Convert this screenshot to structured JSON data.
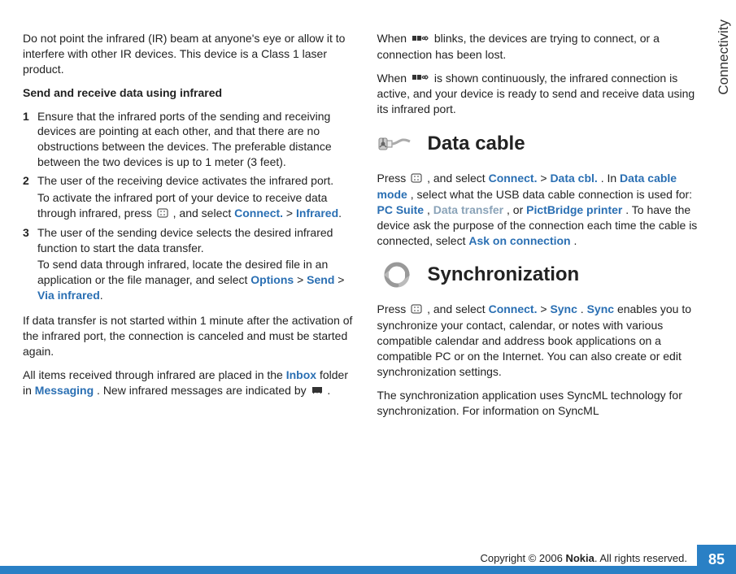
{
  "sideTab": "Connectivity",
  "pageNumber": "85",
  "copyright": {
    "prefix": "Copyright © 2006 ",
    "brand": "Nokia",
    "suffix": ". All rights reserved."
  },
  "left": {
    "intro": "Do not point the infrared (IR) beam at anyone's eye or allow it to interfere with other IR devices. This device is a Class 1 laser product.",
    "subhead": "Send and receive data using infrared",
    "step1": "Ensure that the infrared ports of the sending and receiving devices are pointing at each other, and that there are no obstructions between the devices. The preferable distance between the two devices is up to 1 meter (3 feet).",
    "step2a": "The user of the receiving device activates the infrared port.",
    "step2b_pre": "To activate the infrared port of your device to receive data through infrared, press ",
    "step2b_post": " , and select ",
    "connect": "Connect.",
    "gt1": " > ",
    "infrared": "Infrared",
    "step3a": "The user of the sending device selects the desired infrared function to start the data transfer.",
    "step3b": "To send data through infrared, locate the desired file in an application or the file manager, and select ",
    "options": "Options",
    "gt2": " > ",
    "send": "Send",
    "gt3": " > ",
    "viair": "Via infrared",
    "afterSteps": "If data transfer is not started within 1 minute after the activation of the infrared port, the connection is canceled and must be started again.",
    "inbox_pre": "All items received through infrared are placed in the ",
    "inbox": "Inbox",
    "inbox_mid": " folder in ",
    "messaging": "Messaging",
    "inbox_post": ". New infrared messages are indicated by ",
    "period1": "."
  },
  "right": {
    "blinks_pre": "When ",
    "blinks_post": " blinks, the devices are trying to connect, or a connection has been lost.",
    "cont_pre": "When ",
    "cont_post": " is shown continuously, the infrared connection is active, and your device is ready to send and receive data using its infrared port.",
    "h_data": "Data cable",
    "data_pre": "Press ",
    "data_mid1": " , and select ",
    "connect": "Connect.",
    "gt1": " > ",
    "datacbl": "Data cbl.",
    "data_mid2": ". In ",
    "datacablemode": "Data cable mode",
    "data_mid3": ", select what the USB data cable connection is used for: ",
    "pcsuite": "PC Suite",
    "comma1": ", ",
    "datatransfer": "Data transfer",
    "comma2": ", or ",
    "pictbridge": "PictBridge printer",
    "data_mid4": ". To have the device ask the purpose of the connection each time the cable is connected, select ",
    "askon": "Ask on connection",
    "period2": ".",
    "h_sync": "Synchronization",
    "sync_pre": "Press ",
    "sync_mid1": " , and select ",
    "connect2": "Connect.",
    "gt2": " > ",
    "sync": "Sync",
    "period3": ". ",
    "sync2": "Sync",
    "sync_post": " enables you to synchronize your contact, calendar, or notes with various compatible calendar and address book applications on a compatible PC or on the Internet. You can also create or edit synchronization settings.",
    "syncml": "The synchronization application uses SyncML technology for synchronization. For information on SyncML"
  }
}
